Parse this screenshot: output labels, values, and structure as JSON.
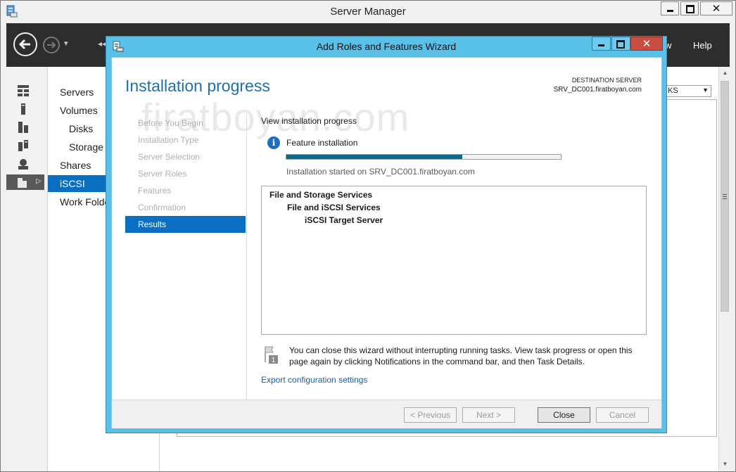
{
  "server_manager": {
    "title": "Server Manager",
    "menu": {
      "view": "w",
      "help": "Help"
    },
    "nav_dropdown_glyph": "▾",
    "crumb_glyph": "◂◂",
    "sub_nav": [
      {
        "label": "Servers"
      },
      {
        "label": "Volumes"
      },
      {
        "label": "Disks"
      },
      {
        "label": "Storage"
      },
      {
        "label": "Shares"
      },
      {
        "label": "iSCSI"
      },
      {
        "label": "Work Folde"
      }
    ],
    "tasks_combo": "KS"
  },
  "wizard": {
    "title": "Add Roles and Features Wizard",
    "page_title": "Installation progress",
    "destination_label": "DESTINATION SERVER",
    "destination_server": "SRV_DC001.firatboyan.com",
    "watermark": "firatboyan.com",
    "steps": [
      {
        "label": "Before You Begin"
      },
      {
        "label": "Installation Type"
      },
      {
        "label": "Server Selection"
      },
      {
        "label": "Server Roles"
      },
      {
        "label": "Features"
      },
      {
        "label": "Confirmation"
      },
      {
        "label": "Results"
      }
    ],
    "view_progress": "View installation progress",
    "feature_installation": "Feature installation",
    "progress_fraction": 0.64,
    "started_text": "Installation started on SRV_DC001.firatboyan.com",
    "results": [
      "File and Storage Services",
      "File and iSCSI Services",
      "iSCSI Target Server"
    ],
    "note": "You can close this wizard without interrupting running tasks. View task progress or open this page again by clicking Notifications in the command bar, and then Task Details.",
    "note_badge": "1",
    "export_link": "Export configuration settings",
    "buttons": {
      "previous": "< Previous",
      "next": "Next >",
      "close": "Close",
      "cancel": "Cancel"
    }
  },
  "colors": {
    "accent_blue": "#0a6fc1",
    "wizard_frame": "#59c0e8",
    "progress_fill": "#0d6a8d",
    "title_blue": "#1f6fa8"
  }
}
